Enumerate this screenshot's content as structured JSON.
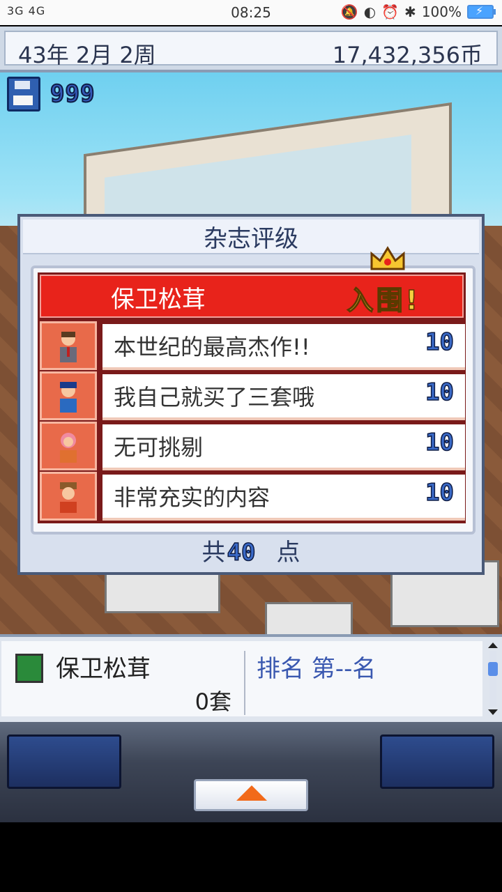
{
  "status_bar": {
    "network": "3G 4G",
    "time": "08:25",
    "battery": "100%"
  },
  "header": {
    "date": "43年 2月 2周",
    "money": "17,432,356币"
  },
  "save": {
    "count": "999"
  },
  "dialog": {
    "title": "杂志评级",
    "magazine_name": "保卫松茸",
    "award": "入围!",
    "reviews": [
      {
        "text": "本世纪的最高杰作!!",
        "score": "10",
        "avatar": "businessman-icon"
      },
      {
        "text": "我自己就买了三套哦",
        "score": "10",
        "avatar": "police-cap-icon"
      },
      {
        "text": "无可挑剔",
        "score": "10",
        "avatar": "pink-hair-girl-icon"
      },
      {
        "text": "非常充实的内容",
        "score": "10",
        "avatar": "brown-hat-man-icon"
      }
    ],
    "total_prefix": "共",
    "total_value": "40",
    "total_suffix": "点"
  },
  "info": {
    "title": "保卫松茸",
    "sets": "0套",
    "rank": "排名 第--名"
  },
  "colors": {
    "accent_red": "#e8231b",
    "score_blue": "#3a6ac8",
    "title_navy": "#2a3a60"
  }
}
